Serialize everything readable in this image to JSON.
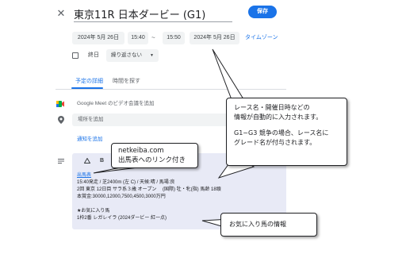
{
  "editor": {
    "title": "東京11R 日本ダービー (G1)",
    "save_label": "保存",
    "start_date": "2024年 5月 26日",
    "start_time": "15:40",
    "separator": "~",
    "end_time": "15:50",
    "end_date": "2024年 5月 26日",
    "timezone_label": "タイムゾーン",
    "allday_label": "終日",
    "repeat_value": "繰り返さない",
    "tabs": [
      {
        "label": "予定の詳細"
      },
      {
        "label": "時間を探す"
      }
    ],
    "meet_label": "Google Meet のビデオ会議を追加",
    "location_placeholder": "場所を追加",
    "notification_link": "通知を追加",
    "format_bold": "B",
    "description": {
      "link_text": "出馬表",
      "line2": "15:40発走 / 芝2400m (左 C) / 天候:晴 / 馬場:良",
      "line3": "2回 東京 12日目 サラ系３歳 オープン　 (国際) 牡・牝(指) 馬齢 18頭",
      "line4": "本賞金:30000,12000,7500,4500,3000万円",
      "line5": "★お気に入り馬",
      "line6": "1枠2番 レガレイラ (2024ダービー 紅一点)"
    }
  },
  "callouts": {
    "main_1": "レース名・開催日時などの",
    "main_2": "情報が自動的に入力されます。",
    "main_3": "G1~G3 競争の場合、レース名に",
    "main_4": "グレード名が付与されます。",
    "netkeiba_1": "netkeiba.com",
    "netkeiba_2": "出馬表へのリンク付き",
    "favorite": "お気に入り馬の情報"
  },
  "colors": {
    "accent": "#1a73e8",
    "description_bg": "#e8eaf6",
    "field_bg": "#f1f3f4"
  },
  "icons": [
    "close-icon",
    "video-camera-icon",
    "location-pin-icon",
    "notes-icon",
    "drive-icon",
    "bold-icon"
  ]
}
